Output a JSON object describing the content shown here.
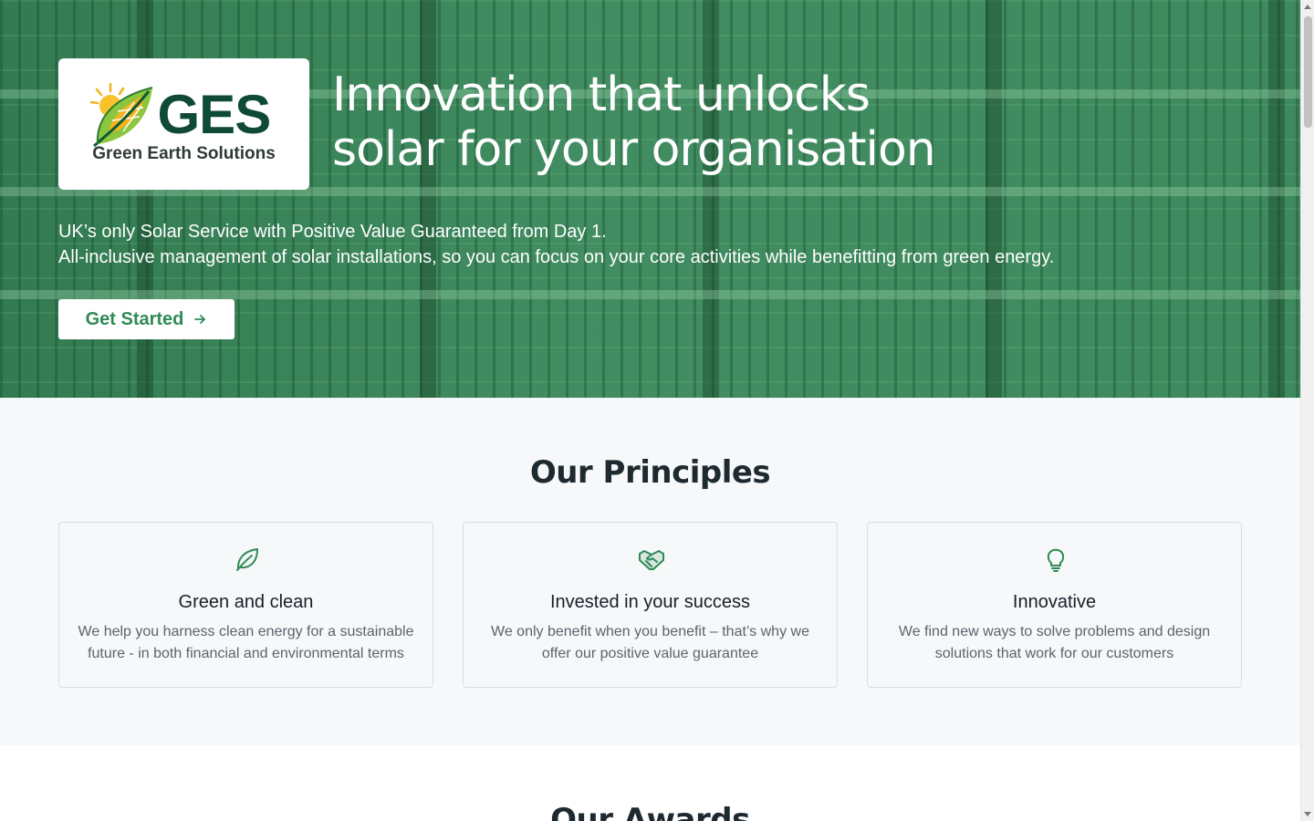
{
  "brand": {
    "logo_letters": "GES",
    "logo_subtitle": "Green Earth Solutions"
  },
  "hero": {
    "title_line1": "Innovation that unlocks",
    "title_line2": "solar for your organisation",
    "subtitle_line1": "UK’s only Solar Service with Positive Value Guaranteed from Day 1.",
    "subtitle_line2": "All-inclusive management of solar installations, so you can focus on your core activities while benefitting from green energy.",
    "cta_label": "Get Started",
    "cta_icon": "arrow-right-icon"
  },
  "principles": {
    "title": "Our Principles",
    "cards": [
      {
        "icon": "leaf-icon",
        "title": "Green and clean",
        "body_line1": "We help you harness clean energy for a sustainable",
        "body_line2": "future - in both financial and environmental terms"
      },
      {
        "icon": "handshake-icon",
        "title": "Invested in your success",
        "body_line1": "We only benefit when you benefit – that’s why we",
        "body_line2": "offer our positive value guarantee"
      },
      {
        "icon": "lightbulb-icon",
        "title": "Innovative",
        "body_line1": "We find new ways to solve problems and design",
        "body_line2": "solutions that work for our customers"
      }
    ]
  },
  "awards": {
    "title": "Our Awards"
  },
  "colors": {
    "brand_green": "#2f8a55",
    "hero_green": "#3f8a5f",
    "logo_dark_green": "#0f4a34",
    "section_bg": "#f6f8f9"
  }
}
